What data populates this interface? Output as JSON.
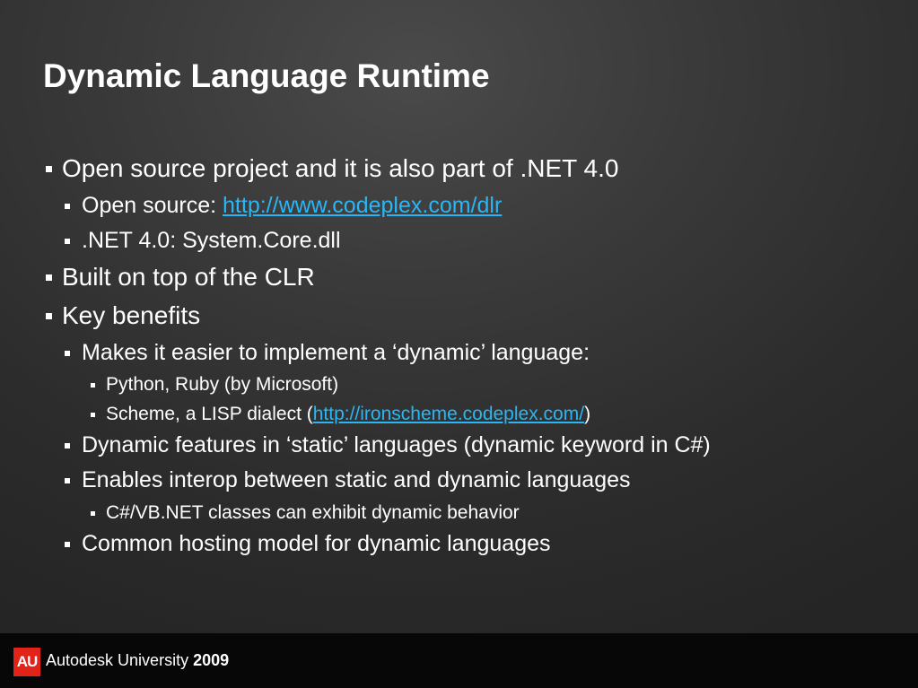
{
  "slide": {
    "title": "Dynamic Language Runtime"
  },
  "bullets": [
    {
      "text": "Open source project and it is also part of .NET 4.0"
    },
    {
      "prefix": "Open source: ",
      "link": "http://www.codeplex.com/dlr"
    },
    {
      "text": ".NET 4.0: System.Core.dll"
    },
    {
      "text": "Built on top of the CLR"
    },
    {
      "text": "Key benefits"
    },
    {
      "text": "Makes it easier to implement a ‘dynamic’ language:"
    },
    {
      "text": "Python, Ruby (by Microsoft)"
    },
    {
      "prefix": "Scheme, a LISP dialect (",
      "link": "http://ironscheme.codeplex.com/",
      "suffix": ")"
    },
    {
      "text": "Dynamic features in ‘static’ languages (dynamic keyword in C#)"
    },
    {
      "text": "Enables interop between static and dynamic languages"
    },
    {
      "text": "C#/VB.NET classes can exhibit dynamic behavior"
    },
    {
      "text": "Common hosting model for dynamic languages"
    }
  ],
  "footer": {
    "badge": "AU",
    "brand": "Autodesk University",
    "year": "2009"
  },
  "colors": {
    "link": "#29b6f6",
    "badge": "#e2231a",
    "text": "#ffffff"
  }
}
